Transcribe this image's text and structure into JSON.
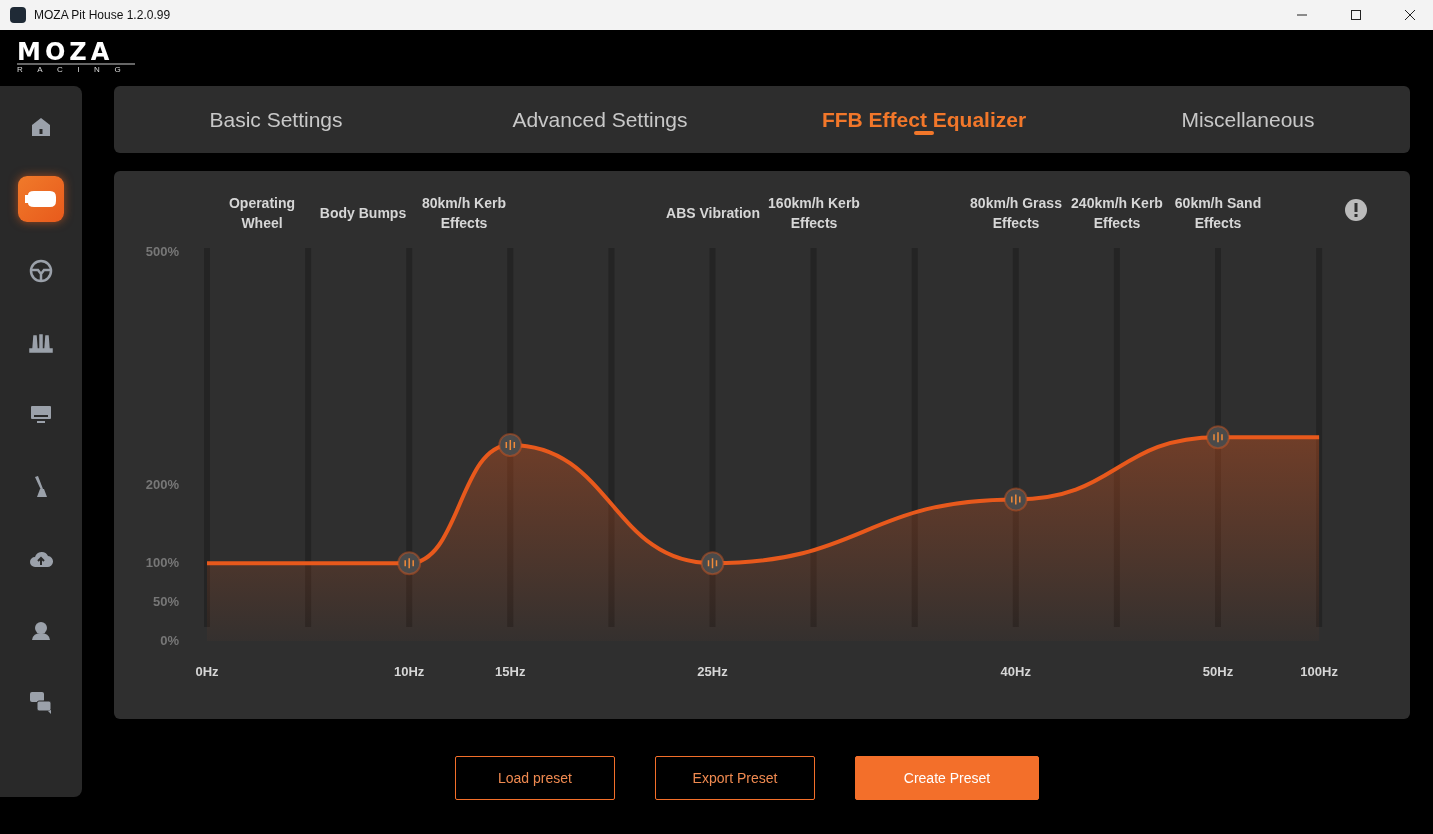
{
  "window": {
    "title": "MOZA Pit House 1.2.0.99"
  },
  "logo": {
    "name": "MOZA",
    "tagline": "RACING"
  },
  "sidebar": {
    "items": [
      {
        "selected": false
      },
      {
        "selected": true
      },
      {
        "selected": false
      },
      {
        "selected": false
      },
      {
        "selected": false
      },
      {
        "selected": false
      },
      {
        "selected": false
      },
      {
        "selected": false
      },
      {
        "selected": false
      }
    ]
  },
  "tabs": [
    {
      "label": "Basic Settings",
      "selected": false
    },
    {
      "label": "Advanced Settings",
      "selected": false
    },
    {
      "label": "FFB Effect Equalizer",
      "selected": true
    },
    {
      "label": "Miscellaneous",
      "selected": false
    }
  ],
  "equalizer": {
    "effects": [
      {
        "label": "Operating Wheel"
      },
      {
        "label": "Body Bumps"
      },
      {
        "label": "80km/h Kerb Effects"
      },
      {
        "label": "ABS Vibration"
      },
      {
        "label": "160km/h Kerb Effects"
      },
      {
        "label": "80km/h Grass Effects"
      },
      {
        "label": "240km/h Kerb Effects"
      },
      {
        "label": "60km/h Sand Effects"
      }
    ],
    "chart_data": {
      "type": "line",
      "categories": [
        "0Hz",
        null,
        "10Hz",
        "15Hz",
        null,
        "25Hz",
        null,
        null,
        "40Hz",
        null,
        "50Hz",
        "100Hz"
      ],
      "series": [
        {
          "color": "#e8591c",
          "values": [
            100,
            null,
            100,
            252,
            null,
            100,
            null,
            null,
            182,
            null,
            262,
            262
          ]
        }
      ],
      "ylim": [
        0,
        500
      ],
      "grid": true,
      "yticks": [
        {
          "value": 0,
          "label": "0%"
        },
        {
          "value": 50,
          "label": "50%"
        },
        {
          "value": 100,
          "label": "100%"
        },
        {
          "value": 200,
          "label": "200%"
        },
        {
          "value": 500,
          "label": "500%"
        }
      ]
    }
  },
  "buttons": [
    {
      "label": "Load preset",
      "kind": "outline"
    },
    {
      "label": "Export Preset",
      "kind": "outline"
    },
    {
      "label": "Create Preset",
      "kind": "primary"
    }
  ]
}
